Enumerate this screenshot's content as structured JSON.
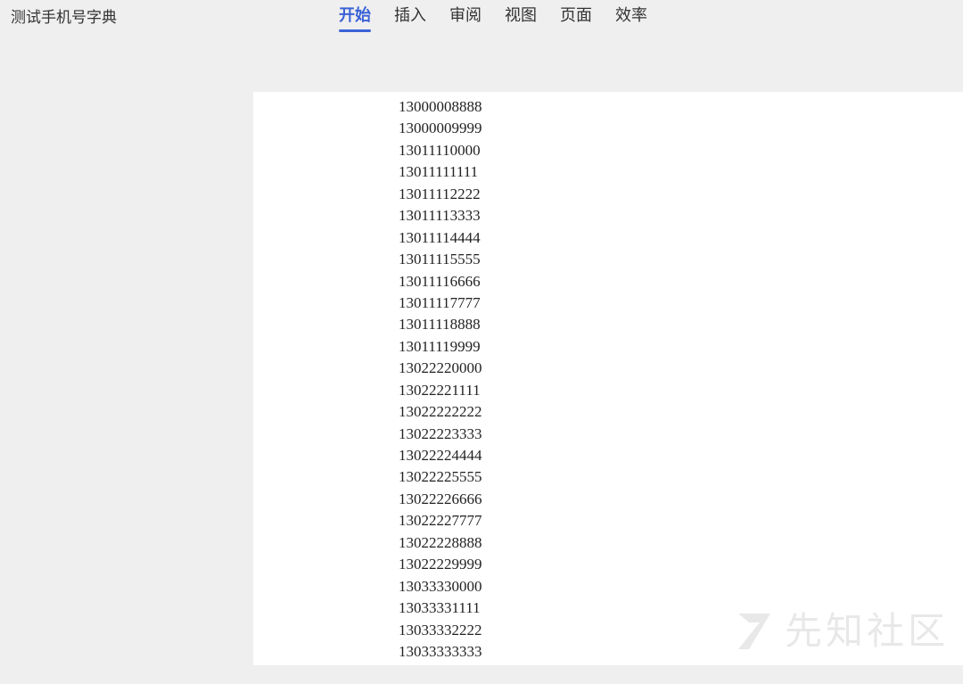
{
  "document": {
    "title": "测试手机号字典"
  },
  "ribbon": {
    "tabs": [
      {
        "label": "开始",
        "active": true
      },
      {
        "label": "插入",
        "active": false
      },
      {
        "label": "审阅",
        "active": false
      },
      {
        "label": "视图",
        "active": false
      },
      {
        "label": "页面",
        "active": false
      },
      {
        "label": "效率",
        "active": false
      }
    ]
  },
  "content": {
    "lines": [
      "13000008888",
      "13000009999",
      "13011110000",
      "13011111111",
      "13011112222",
      "13011113333",
      "13011114444",
      "13011115555",
      "13011116666",
      "13011117777",
      "13011118888",
      "13011119999",
      "13022220000",
      "13022221111",
      "13022222222",
      "13022223333",
      "13022224444",
      "13022225555",
      "13022226666",
      "13022227777",
      "13022228888",
      "13022229999",
      "13033330000",
      "13033331111",
      "13033332222",
      "13033333333"
    ]
  },
  "watermark": {
    "text": "先知社区",
    "icon": "xianzhi-logo-icon"
  }
}
